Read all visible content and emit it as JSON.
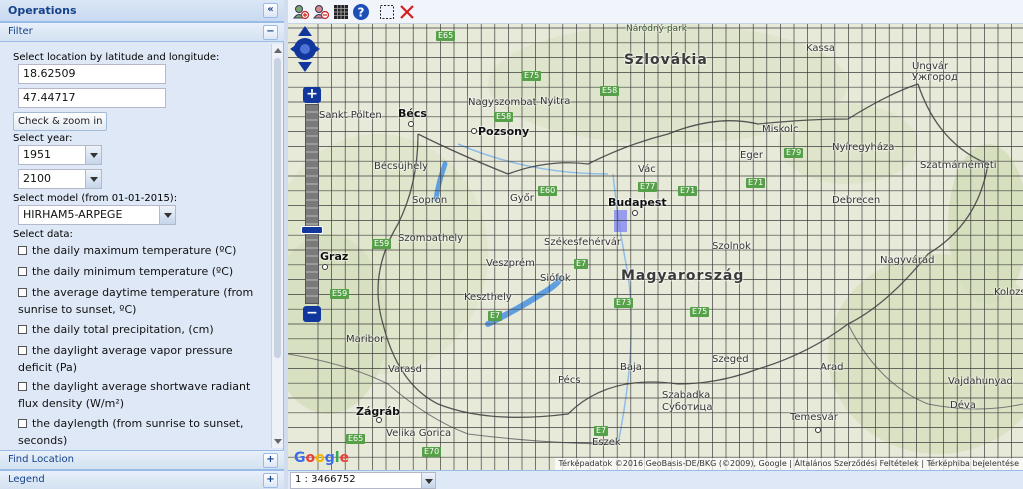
{
  "sidebar": {
    "title": "Operations",
    "collapse_icon": "double-chevron-left-icon",
    "filter": {
      "title": "Filter",
      "location_label": "Select location by latitude and longitude:",
      "longitude_value": "18.62509",
      "latitude_value": "47.44717",
      "check_zoom_label": "Check & zoom in",
      "year_label": "Select year:",
      "year_from": "1951",
      "year_to": "2100",
      "model_label": "Select model (from 01-01-2015):",
      "model_value": "HIRHAM5-ARPEGE",
      "data_label": "Select data:",
      "data_options": [
        "the daily maximum temperature (ºC)",
        "the daily minimum temperature (ºC)",
        "the average daytime temperature (from sunrise to sunset, ºC)",
        "the daily total precipitation, (cm)",
        "the daylight average vapor pressure deficit (Pa)",
        "the daylight average shortwave radiant flux density (W/m²)",
        "the daylength (from sunrise to sunset, seconds)"
      ]
    },
    "find_location": "Find Location",
    "legend": "Legend"
  },
  "toolbar": {
    "icons": [
      "zoom-in-user-icon",
      "zoom-out-user-icon",
      "grid-icon",
      "help-icon",
      "select-box-icon",
      "clear-icon"
    ]
  },
  "map": {
    "labels": {
      "szlovakia": "Szlovákia",
      "magyarorszag": "Magyarország",
      "kassa": "Kassa",
      "uzhgorod": "Szlovákia",
      "uzhgorod_a": "Ужгород",
      "uzhgorod_b": "Ungvár",
      "narodny": "Národný park",
      "becs": "Bécs",
      "pozsony": "Pozsony",
      "nagyszombat": "Nagyszombat",
      "nyitra": "Nyitra",
      "sankt_polten": "Sankt Pölten",
      "miskolc": "Miskolc",
      "nyiregyhaza": "Nyíregyháza",
      "szatmarnemeti": "Szatmárnémeti",
      "eger": "Eger",
      "vac": "Vác",
      "budapest": "Budapest",
      "gyor": "Győr",
      "sopron": "Sopron",
      "becsujhely": "Bécsújhely",
      "szombathely": "Szombathely",
      "szekesfehervar": "Székesfehérvár",
      "debrecen": "Debrecen",
      "szolnok": "Szolnok",
      "nagyvarad": "Nagyvárad",
      "graz": "Graz",
      "veszprem": "Veszprém",
      "siofok": "Siófok",
      "keszthely": "Keszthely",
      "kolozs": "Kolozs",
      "maribor": "Maribor",
      "varasd": "Varasd",
      "szeged": "Szeged",
      "arad": "Arad",
      "baja": "Baja",
      "pecs": "Pécs",
      "szabadka": "Szabadka",
      "subotica": "Суботица",
      "vajdahunyad": "Vajdahunyad",
      "deva": "Déva",
      "zagrab": "Zágráb",
      "velika_gorica": "Velika Gorica",
      "temesvar": "Temesvár",
      "eszek": "Eszek",
      "roads": [
        "E65",
        "E75",
        "E58",
        "E58",
        "E71",
        "E77",
        "E71",
        "E79",
        "E60",
        "E59",
        "E7",
        "E7",
        "E59",
        "E73",
        "E75",
        "E7",
        "E65",
        "E70"
      ]
    },
    "attribution": "Térképadatok ©2016 GeoBasis-DE/BKG (©2009), Google | Általános Szerződési Feltételek | Térképhiba bejelentése",
    "google": [
      "G",
      "o",
      "o",
      "g",
      "l",
      "e"
    ],
    "zoom_in": "+",
    "zoom_out": "−"
  },
  "statusbar": {
    "scale_value": "1 : 3466752"
  },
  "colors": {
    "panel_title": "#15428b",
    "zoom_control": "#11379d",
    "water": "#5f9fe0",
    "grid": "#3e3e3e",
    "selected_cell": "#7d82f0"
  }
}
